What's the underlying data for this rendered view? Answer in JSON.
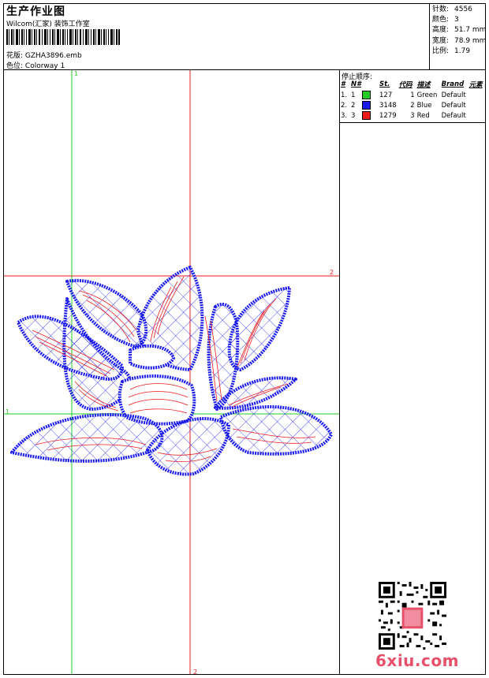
{
  "header": {
    "title": "生产作业图",
    "studio": "Wilcom(汇家) 装饰工作室",
    "design_label": "花版:",
    "design_value": "GZHA3896.emb",
    "colorway_label": "色位:",
    "colorway_value": "Colorway 1"
  },
  "stats": {
    "stitches_label": "针数:",
    "stitches": "4556",
    "colors_label": "颜色:",
    "colors": "3",
    "height_label": "高度:",
    "height": "51.7 mm",
    "width_label": "宽度:",
    "width": "78.9 mm",
    "scale_label": "比例:",
    "scale": "1.79"
  },
  "stop_sequence": {
    "title": "停止顺序:",
    "headers": [
      "#",
      "N#",
      "St.",
      "代码",
      "描述",
      "Brand",
      "元素"
    ],
    "rows": [
      {
        "idx": "1.",
        "n": "1",
        "color": "#22cc22",
        "st": "127",
        "code": "1",
        "desc": "Green",
        "brand": "Default"
      },
      {
        "idx": "2.",
        "n": "2",
        "color": "#1a1aee",
        "st": "3148",
        "code": "2",
        "desc": "Blue",
        "brand": "Default"
      },
      {
        "idx": "3.",
        "n": "3",
        "color": "#ee1a1a",
        "st": "1279",
        "code": "3",
        "desc": "Red",
        "brand": "Default"
      }
    ]
  },
  "guides": {
    "label_1": "1",
    "label_2": "2",
    "green": "#22cc22",
    "red": "#ee1a1a"
  },
  "design_colors": {
    "outline": "#1a1aee",
    "fill": "#ee1a1a"
  },
  "watermark": "6xiu.com"
}
